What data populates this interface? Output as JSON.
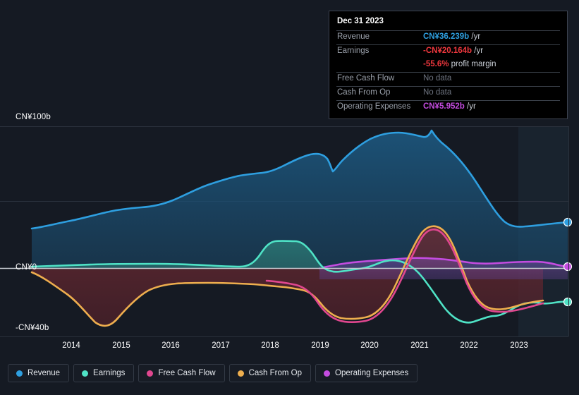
{
  "tooltip": {
    "title": "Dec 31 2023",
    "rows": [
      {
        "key": "Revenue",
        "value": "CN¥36.239b",
        "unit": "/yr",
        "color": "#2e9fe0",
        "nodata": false
      },
      {
        "key": "Earnings",
        "value": "-CN¥20.164b",
        "unit": "/yr",
        "color": "#f0383e",
        "nodata": false
      },
      {
        "key": "",
        "value": "-55.6%",
        "unit": "profit margin",
        "color": "#f0383e",
        "nodata": false
      },
      {
        "key": "Free Cash Flow",
        "value": "No data",
        "unit": "",
        "color": "#6e7480",
        "nodata": true
      },
      {
        "key": "Cash From Op",
        "value": "No data",
        "unit": "",
        "color": "#6e7480",
        "nodata": true
      },
      {
        "key": "Operating Expenses",
        "value": "CN¥5.952b",
        "unit": "/yr",
        "color": "#c44ce0",
        "nodata": false
      }
    ]
  },
  "legend": {
    "items": [
      {
        "label": "Revenue",
        "color": "#2e9fe0"
      },
      {
        "label": "Earnings",
        "color": "#4fe3c6"
      },
      {
        "label": "Free Cash Flow",
        "color": "#e0478f"
      },
      {
        "label": "Cash From Op",
        "color": "#eeae4e"
      },
      {
        "label": "Operating Expenses",
        "color": "#c44ce0"
      }
    ]
  },
  "axes": {
    "y_ticks": [
      {
        "label": "CN¥100b",
        "value": 100
      },
      {
        "label": "CN¥0",
        "value": 0
      },
      {
        "label": "-CN¥40b",
        "value": -40
      }
    ],
    "x_ticks": [
      "2014",
      "2015",
      "2016",
      "2017",
      "2018",
      "2019",
      "2020",
      "2021",
      "2022",
      "2023"
    ]
  },
  "chart_data": {
    "type": "area",
    "title": "",
    "xlabel": "",
    "ylabel": "CN¥",
    "currency": "CN¥",
    "unit": "b",
    "ylim": [
      -46,
      108
    ],
    "y_gridlines": [
      100,
      50,
      0,
      -40
    ],
    "grid": true,
    "legend_position": "bottom",
    "x_range": [
      "2013-06",
      "2023-12"
    ],
    "x_tick_labels": [
      "2014",
      "2015",
      "2016",
      "2017",
      "2018",
      "2019",
      "2020",
      "2021",
      "2022",
      "2023"
    ],
    "forecast_shading_from": "2023-03",
    "series": [
      {
        "name": "Revenue",
        "color": "#2e9fe0",
        "fill": "rgba(38,110,160,0.45)",
        "end_value": 36.239,
        "x": [
          "2013.4",
          "2013.9",
          "2014.4",
          "2014.9",
          "2015.4",
          "2015.9",
          "2016.4",
          "2016.9",
          "2017.4",
          "2017.9",
          "2018.4",
          "2018.9",
          "2019.1",
          "2019.4",
          "2019.9",
          "2020.4",
          "2020.9",
          "2021.1",
          "2021.4",
          "2021.9",
          "2022.4",
          "2022.9",
          "2023.2",
          "2023.9"
        ],
        "values": [
          27.5,
          30.5,
          33.5,
          36.5,
          37.0,
          38.5,
          42.0,
          47.5,
          55.0,
          64.0,
          74.5,
          76.0,
          73.5,
          71.0,
          79.0,
          86.5,
          88.5,
          86.0,
          95.0,
          88.0,
          70.0,
          50.0,
          37.5,
          36.24
        ]
      },
      {
        "name": "Earnings",
        "color": "#4fe3c6",
        "fill": "rgba(42,120,116,0.50)",
        "end_value": -20.164,
        "x": [
          "2013.4",
          "2014.4",
          "2015.4",
          "2016.4",
          "2017.4",
          "2017.9",
          "2018.2",
          "2018.6",
          "2019.0",
          "2019.4",
          "2019.9",
          "2020.4",
          "2020.9",
          "2021.2",
          "2021.5",
          "2021.9",
          "2022.4",
          "2022.9",
          "2023.2",
          "2023.6",
          "2023.9"
        ],
        "values": [
          1.0,
          1.0,
          1.2,
          1.7,
          1.0,
          1.0,
          7.5,
          7.6,
          1.2,
          -1.0,
          -0.5,
          0.0,
          0.5,
          2.0,
          1.0,
          -2.0,
          -20.0,
          -32.0,
          -24.0,
          -21.5,
          -20.16
        ]
      },
      {
        "name": "Free Cash Flow",
        "color": "#e0478f",
        "fill": "rgba(120,40,50,0.45)",
        "end_value": null,
        "end_note": "No data",
        "x": [
          "2018.0",
          "2018.6",
          "2019.2",
          "2019.6",
          "2020.0",
          "2020.4",
          "2020.9",
          "2021.2",
          "2021.5",
          "2021.9",
          "2022.4",
          "2022.9",
          "2023.1"
        ],
        "values": [
          -8.5,
          -9.5,
          -11.0,
          -22.0,
          -31.5,
          -32.0,
          -31.0,
          -8.0,
          12.5,
          12.8,
          -4.5,
          -6.0,
          -4.5
        ]
      },
      {
        "name": "Cash From Op",
        "color": "#eeae4e",
        "fill": "rgba(120,80,40,0.35)",
        "end_value": null,
        "end_note": "No data",
        "x": [
          "2013.4",
          "2013.9",
          "2014.4",
          "2014.9",
          "2015.2",
          "2015.6",
          "2016.2",
          "2016.8",
          "2017.2",
          "2017.6",
          "2018.0",
          "2018.6",
          "2019.2",
          "2019.6",
          "2020.0",
          "2020.4",
          "2020.9",
          "2021.2",
          "2021.5",
          "2021.9",
          "2022.4",
          "2022.9",
          "2023.3"
        ],
        "values": [
          -3.0,
          -8.0,
          -18.0,
          -30.0,
          -36.0,
          -33.0,
          -22.0,
          -6.0,
          -3.5,
          -3.5,
          -7.0,
          -8.0,
          -10.0,
          -20.0,
          -29.5,
          -30.5,
          -29.0,
          -6.0,
          14.0,
          14.0,
          -2.0,
          -3.5,
          -1.0
        ]
      },
      {
        "name": "Operating Expenses",
        "color": "#c44ce0",
        "fill": "rgba(110,55,140,0.38)",
        "end_value": 5.952,
        "x": [
          "2019.0",
          "2019.5",
          "2020.0",
          "2020.6",
          "2021.2",
          "2021.6",
          "2022.0",
          "2022.4",
          "2022.9",
          "2023.3",
          "2023.9"
        ],
        "values": [
          2.0,
          2.6,
          3.6,
          4.0,
          4.4,
          4.2,
          4.1,
          4.0,
          6.0,
          6.1,
          5.95
        ]
      }
    ]
  }
}
